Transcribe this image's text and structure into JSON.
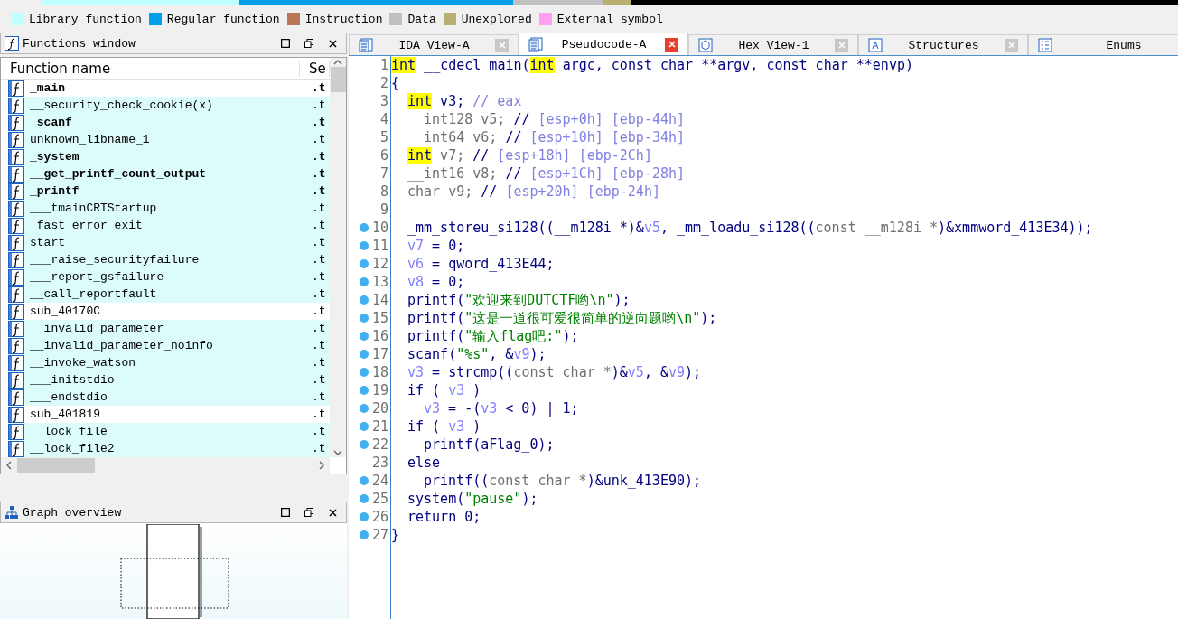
{
  "legend": [
    {
      "label": "Library function",
      "color": "#c0ffff"
    },
    {
      "label": "Regular function",
      "color": "#00a0e8"
    },
    {
      "label": "Instruction",
      "color": "#b87858"
    },
    {
      "label": "Data",
      "color": "#c0c0c0"
    },
    {
      "label": "Unexplored",
      "color": "#b8b070"
    },
    {
      "label": "External symbol",
      "color": "#ffa0f0"
    }
  ],
  "functions_window": {
    "title": "Functions window",
    "columns": [
      "Function name",
      "Se"
    ],
    "rows": [
      {
        "name": "_main",
        "segment": ".t",
        "bold": true,
        "kind": "regular"
      },
      {
        "name": "__security_check_cookie(x)",
        "segment": ".t",
        "bold": false,
        "kind": "library"
      },
      {
        "name": "_scanf",
        "segment": ".t",
        "bold": true,
        "kind": "library"
      },
      {
        "name": "unknown_libname_1",
        "segment": ".t",
        "bold": false,
        "kind": "library"
      },
      {
        "name": "_system",
        "segment": ".t",
        "bold": true,
        "kind": "library"
      },
      {
        "name": "__get_printf_count_output",
        "segment": ".t",
        "bold": true,
        "kind": "library"
      },
      {
        "name": "_printf",
        "segment": ".t",
        "bold": true,
        "kind": "library"
      },
      {
        "name": "___tmainCRTStartup",
        "segment": ".t",
        "bold": false,
        "kind": "library"
      },
      {
        "name": "_fast_error_exit",
        "segment": ".t",
        "bold": false,
        "kind": "library"
      },
      {
        "name": "start",
        "segment": ".t",
        "bold": false,
        "kind": "library"
      },
      {
        "name": "___raise_securityfailure",
        "segment": ".t",
        "bold": false,
        "kind": "library"
      },
      {
        "name": "___report_gsfailure",
        "segment": ".t",
        "bold": false,
        "kind": "library"
      },
      {
        "name": "__call_reportfault",
        "segment": ".t",
        "bold": false,
        "kind": "library"
      },
      {
        "name": "sub_40170C",
        "segment": ".t",
        "bold": false,
        "kind": "regular"
      },
      {
        "name": "__invalid_parameter",
        "segment": ".t",
        "bold": false,
        "kind": "library"
      },
      {
        "name": "__invalid_parameter_noinfo",
        "segment": ".t",
        "bold": false,
        "kind": "library"
      },
      {
        "name": "__invoke_watson",
        "segment": ".t",
        "bold": false,
        "kind": "library"
      },
      {
        "name": "___initstdio",
        "segment": ".t",
        "bold": false,
        "kind": "library"
      },
      {
        "name": "___endstdio",
        "segment": ".t",
        "bold": false,
        "kind": "library"
      },
      {
        "name": "sub_401819",
        "segment": ".t",
        "bold": false,
        "kind": "regular"
      },
      {
        "name": "__lock_file",
        "segment": ".t",
        "bold": false,
        "kind": "library"
      },
      {
        "name": "__lock_file2",
        "segment": ".t",
        "bold": false,
        "kind": "library"
      }
    ]
  },
  "graph_overview": {
    "title": "Graph overview"
  },
  "tabs": [
    {
      "label": "IDA View-A",
      "selected": false,
      "closable": true
    },
    {
      "label": "Pseudocode-A",
      "selected": true,
      "closable": true
    },
    {
      "label": "Hex View-1",
      "selected": false,
      "closable": true
    },
    {
      "label": "Structures",
      "selected": false,
      "closable": true
    },
    {
      "label": "Enums",
      "selected": false,
      "closable": false
    }
  ],
  "code": [
    {
      "num": "1",
      "breakpoint": false,
      "kind": "top",
      "tokens": [
        {
          "kind": "hl",
          "text": "int"
        },
        {
          "kind": "plain",
          "text": " __cdecl main("
        },
        {
          "kind": "hl",
          "text": "int"
        },
        {
          "kind": "plain",
          "text": " argc, const char **argv, const char **envp)"
        }
      ]
    },
    {
      "num": "2",
      "breakpoint": false,
      "kind": "top",
      "tokens": [
        {
          "kind": "plain",
          "text": "{"
        }
      ]
    },
    {
      "num": "3",
      "breakpoint": false,
      "kind": "body",
      "tokens": [
        {
          "kind": "hl",
          "text": "int"
        },
        {
          "kind": "plain",
          "text": " v3; "
        },
        {
          "kind": "comment",
          "text": "// eax"
        }
      ]
    },
    {
      "num": "4",
      "breakpoint": false,
      "kind": "body",
      "tokens": [
        {
          "kind": "cast",
          "text": "__int128 v5; "
        },
        {
          "kind": "plain",
          "text": "// "
        },
        {
          "kind": "comment",
          "text": "[esp+0h] [ebp-44h]"
        }
      ]
    },
    {
      "num": "5",
      "breakpoint": false,
      "kind": "body",
      "tokens": [
        {
          "kind": "cast",
          "text": "__int64 v6; "
        },
        {
          "kind": "plain",
          "text": "// "
        },
        {
          "kind": "comment",
          "text": "[esp+10h] [ebp-34h]"
        }
      ]
    },
    {
      "num": "6",
      "breakpoint": false,
      "kind": "body",
      "tokens": [
        {
          "kind": "hl",
          "text": "int"
        },
        {
          "kind": "cast",
          "text": " v7; "
        },
        {
          "kind": "plain",
          "text": "// "
        },
        {
          "kind": "comment",
          "text": "[esp+18h] [ebp-2Ch]"
        }
      ]
    },
    {
      "num": "7",
      "breakpoint": false,
      "kind": "body",
      "tokens": [
        {
          "kind": "cast",
          "text": "__int16 v8; "
        },
        {
          "kind": "plain",
          "text": "// "
        },
        {
          "kind": "comment",
          "text": "[esp+1Ch] [ebp-28h]"
        }
      ]
    },
    {
      "num": "8",
      "breakpoint": false,
      "kind": "body",
      "tokens": [
        {
          "kind": "cast",
          "text": "char v9; "
        },
        {
          "kind": "plain",
          "text": "// "
        },
        {
          "kind": "comment",
          "text": "[esp+20h] [ebp-24h]"
        }
      ]
    },
    {
      "num": "9",
      "breakpoint": false
    },
    {
      "num": "10",
      "breakpoint": true,
      "kind": "body",
      "tokens": [
        {
          "kind": "plain",
          "text": "_mm_storeu_si128((__m128i *)&"
        },
        {
          "kind": "var",
          "text": "v5"
        },
        {
          "kind": "plain",
          "text": ", _mm_loadu_si128(("
        },
        {
          "kind": "cast",
          "text": "const __m128i *"
        },
        {
          "kind": "plain",
          "text": ")&xmmword_413E34));"
        }
      ]
    },
    {
      "num": "11",
      "breakpoint": true,
      "kind": "body",
      "tokens": [
        {
          "kind": "var",
          "text": "v7"
        },
        {
          "kind": "plain",
          "text": " = 0;"
        }
      ]
    },
    {
      "num": "12",
      "breakpoint": true,
      "kind": "body",
      "tokens": [
        {
          "kind": "var",
          "text": "v6"
        },
        {
          "kind": "plain",
          "text": " = qword_413E44;"
        }
      ]
    },
    {
      "num": "13",
      "breakpoint": true,
      "kind": "body",
      "tokens": [
        {
          "kind": "var",
          "text": "v8"
        },
        {
          "kind": "plain",
          "text": " = 0;"
        }
      ]
    },
    {
      "num": "14",
      "breakpoint": true,
      "kind": "body",
      "tokens": [
        {
          "kind": "plain",
          "text": "printf("
        },
        {
          "kind": "string",
          "text": "\"欢迎来到DUTCTF哟\\n\""
        },
        {
          "kind": "plain",
          "text": ");"
        }
      ]
    },
    {
      "num": "15",
      "breakpoint": true,
      "kind": "body",
      "tokens": [
        {
          "kind": "plain",
          "text": "printf("
        },
        {
          "kind": "string",
          "text": "\"这是一道很可爱很简单的逆向题哟\\n\""
        },
        {
          "kind": "plain",
          "text": ");"
        }
      ]
    },
    {
      "num": "16",
      "breakpoint": true,
      "kind": "body",
      "tokens": [
        {
          "kind": "plain",
          "text": "printf("
        },
        {
          "kind": "string",
          "text": "\"输入flag吧:\""
        },
        {
          "kind": "plain",
          "text": ");"
        }
      ]
    },
    {
      "num": "17",
      "breakpoint": true,
      "kind": "body",
      "tokens": [
        {
          "kind": "plain",
          "text": "scanf("
        },
        {
          "kind": "string",
          "text": "\"%s\""
        },
        {
          "kind": "plain",
          "text": ", &"
        },
        {
          "kind": "var",
          "text": "v9"
        },
        {
          "kind": "plain",
          "text": ");"
        }
      ]
    },
    {
      "num": "18",
      "breakpoint": true,
      "kind": "body",
      "tokens": [
        {
          "kind": "var",
          "text": "v3"
        },
        {
          "kind": "plain",
          "text": " = strcmp(("
        },
        {
          "kind": "cast",
          "text": "const char *"
        },
        {
          "kind": "plain",
          "text": ")&"
        },
        {
          "kind": "var",
          "text": "v5"
        },
        {
          "kind": "plain",
          "text": ", &"
        },
        {
          "kind": "var",
          "text": "v9"
        },
        {
          "kind": "plain",
          "text": ");"
        }
      ]
    },
    {
      "num": "19",
      "breakpoint": true,
      "kind": "body",
      "tokens": [
        {
          "kind": "plain",
          "text": "if ( "
        },
        {
          "kind": "var",
          "text": "v3"
        },
        {
          "kind": "plain",
          "text": " )"
        }
      ]
    },
    {
      "num": "20",
      "breakpoint": true,
      "kind": "inner",
      "tokens": [
        {
          "kind": "var",
          "text": "v3"
        },
        {
          "kind": "plain",
          "text": " = -("
        },
        {
          "kind": "var",
          "text": "v3"
        },
        {
          "kind": "plain",
          "text": " < 0) | 1;"
        }
      ]
    },
    {
      "num": "21",
      "breakpoint": true,
      "kind": "body",
      "tokens": [
        {
          "kind": "plain",
          "text": "if ( "
        },
        {
          "kind": "var",
          "text": "v3"
        },
        {
          "kind": "plain",
          "text": " )"
        }
      ]
    },
    {
      "num": "22",
      "breakpoint": true,
      "kind": "inner",
      "tokens": [
        {
          "kind": "plain",
          "text": "printf(aFlag_0);"
        }
      ]
    },
    {
      "num": "23",
      "breakpoint": false,
      "kind": "body",
      "tokens": [
        {
          "kind": "plain",
          "text": "else"
        }
      ]
    },
    {
      "num": "24",
      "breakpoint": true,
      "kind": "inner",
      "tokens": [
        {
          "kind": "plain",
          "text": "printf(("
        },
        {
          "kind": "cast",
          "text": "const char *"
        },
        {
          "kind": "plain",
          "text": ")&unk_413E90);"
        }
      ]
    },
    {
      "num": "25",
      "breakpoint": true,
      "kind": "body",
      "tokens": [
        {
          "kind": "plain",
          "text": "system("
        },
        {
          "kind": "string",
          "text": "\"pause\""
        },
        {
          "kind": "plain",
          "text": ");"
        }
      ]
    },
    {
      "num": "26",
      "breakpoint": true,
      "kind": "body",
      "tokens": [
        {
          "kind": "plain",
          "text": "return 0;"
        }
      ]
    },
    {
      "num": "27",
      "breakpoint": true,
      "kind": "top",
      "tokens": [
        {
          "kind": "plain",
          "text": "}"
        }
      ]
    }
  ]
}
